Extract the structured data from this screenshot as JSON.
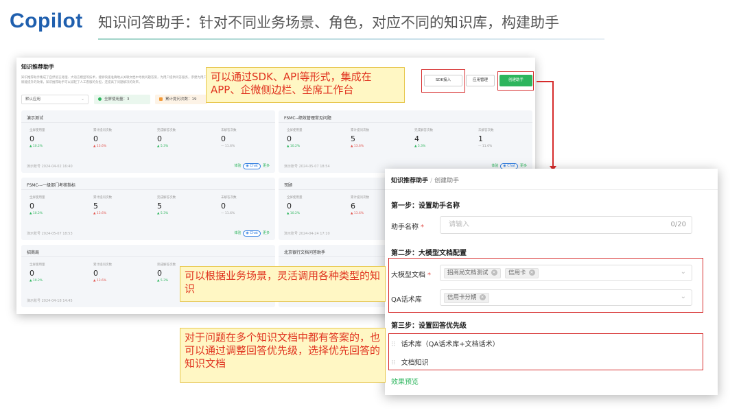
{
  "header": {
    "logo": "Copilot",
    "title": "知识问答助手：针对不同业务场景、角色，对应不同的知识库，构建助手"
  },
  "back": {
    "page_title": "知识推荐助手",
    "description": "知识推荐助手集成了自然语言处理、大语言模型等技术，能够快速准确地从关联文档中寻找问题答案，为用户提供问答服务，参建为用户赋能提升的效果。知识推荐助手可以减轻了人工客服的负担，还提高了问题解决的效率。",
    "filter_select": "默认应用",
    "stat_users": "全屏使用量：3",
    "stat_questions": "累计提问次数：19",
    "btn_sdk": "SDK接入",
    "btn_manage": "应用管理",
    "btn_create": "创建助手",
    "labels": [
      "全屏使用量",
      "累计提问次数",
      "完成解答次数",
      "未解答次数"
    ],
    "chat": "Chat",
    "try": "体验",
    "more": "更多",
    "cards": [
      {
        "title": "演示测试",
        "values": [
          "0",
          "0",
          "0",
          "0"
        ],
        "deltas": [
          "▲ 10.2%",
          "▲ 13.6%",
          "▲ 5.3%",
          "— 11.6%"
        ],
        "foot": "演示账号 2024-04-02 16:40"
      },
      {
        "title": "FSMC--绩效管理常见问题",
        "values": [
          "0",
          "5",
          "4",
          "1"
        ],
        "deltas": [
          "▲ 10.2%",
          "▲ 13.6%",
          "▲ 5.3%",
          "— 11.6%"
        ],
        "foot": "演示账号 2024-05-07 18:54"
      },
      {
        "title": "FSMC---一级部门考核指标",
        "values": [
          "0",
          "5",
          "5",
          "0"
        ],
        "deltas": [
          "▲ 10.2%",
          "▲ 13.6%",
          "▲ 5.3%",
          "— 11.6%"
        ],
        "foot": "演示账号 2024-05-07 18:53"
      },
      {
        "title": "司顾",
        "values": [
          "0",
          "6"
        ],
        "deltas": [
          "▲ 10.2%",
          "▲ 13.6%"
        ],
        "foot": "演示账号 2024-04-24 17:10"
      },
      {
        "title": "招商局",
        "values": [
          "0",
          "0",
          "0"
        ],
        "deltas": [
          "▲ 10.2%",
          "▲ 13.6%",
          "▲ 5.3%"
        ],
        "foot": "演示账号 2024-04-18 14:45"
      },
      {
        "title": "北京银行文档问答助手"
      }
    ]
  },
  "front": {
    "breadcrumb_root": "知识推荐助手",
    "breadcrumb_sep": "/",
    "breadcrumb_current": "创建助手",
    "step1": "第一步：设置助手名称",
    "name_label": "助手名称",
    "required_mark": "*",
    "name_placeholder": "请输入",
    "name_count": "0/20",
    "step2": "第二步：大模型文档配置",
    "doc_label": "大模型文档",
    "doc_tags": [
      "招商局文档测试",
      "信用卡"
    ],
    "qa_label": "QA话术库",
    "qa_tags": [
      "信用卡分期"
    ],
    "step3": "第三步：设置回答优先级",
    "priority_items": [
      "话术库（QA话术库+文档话术）",
      "文档知识"
    ],
    "preview_link": "效果预览"
  },
  "callouts": {
    "c1": "可以通过SDK、API等形式，集成在APP、企微侧边栏、坐席工作台",
    "c2": "可以根据业务场景，灵活调用各种类型的知识",
    "c3": "对于问题在多个知识文档中都有答案的，也可以通过调整回答优先级，选择优先回答的知识文档"
  },
  "colors": {
    "brand": "#1f5fae",
    "accent_green": "#2db55d",
    "highlight_red": "#d62b2b",
    "callout_bg": "#fff7c4",
    "callout_text": "#e0331f"
  }
}
